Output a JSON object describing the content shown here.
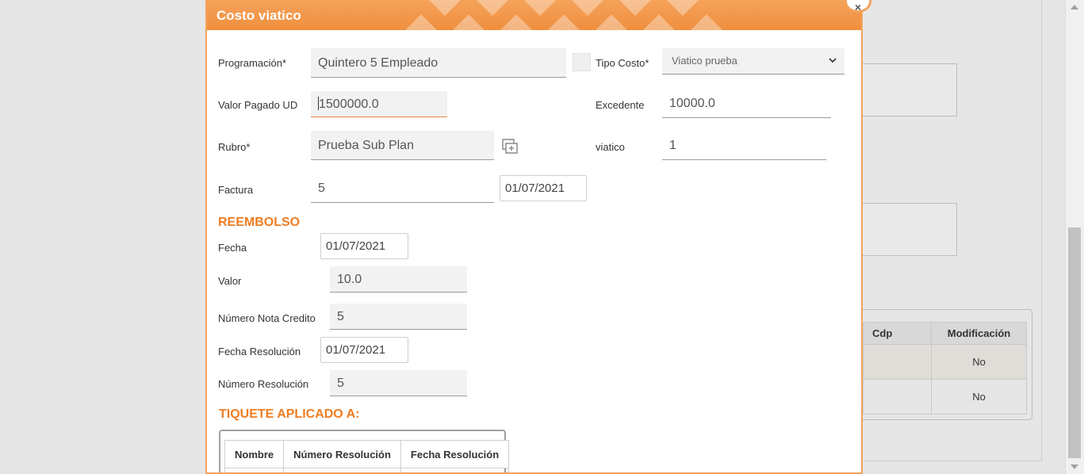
{
  "modal": {
    "title": "Costo viatico",
    "close_symbol": "×"
  },
  "form": {
    "programacion": {
      "label": "Programación*",
      "value": "Quintero 5 Empleado"
    },
    "tipo_costo": {
      "label": "Tipo Costo*",
      "value": "Viatico prueba"
    },
    "valor_pagado": {
      "label": "Valor Pagado UD",
      "value": "1500000.0"
    },
    "excedente": {
      "label": "Excedente",
      "value": "10000.0"
    },
    "rubro": {
      "label": "Rubro*",
      "value": "Prueba Sub Plan"
    },
    "viatico": {
      "label": "viatico",
      "value": "1"
    },
    "factura": {
      "label": "Factura",
      "value": "5",
      "date": "01/07/2021"
    }
  },
  "reembolso": {
    "title": "REEMBOLSO",
    "fecha": {
      "label": "Fecha",
      "value": "01/07/2021"
    },
    "valor": {
      "label": "Valor",
      "value": "10.0"
    },
    "numero_nota": {
      "label": "Número Nota Credito",
      "value": "5"
    },
    "fecha_resolucion": {
      "label": "Fecha Resolución",
      "value": "01/07/2021"
    },
    "numero_resolucion": {
      "label": "Número Resolución",
      "value": "5"
    }
  },
  "tiquete": {
    "title": "TIQUETE APLICADO A:",
    "columns": [
      "Nombre",
      "Número Resolución",
      "Fecha Resolución"
    ]
  },
  "background_table": {
    "columns": [
      "Cdp",
      "Modificación"
    ],
    "rows": [
      [
        "",
        "No"
      ],
      [
        "",
        "No"
      ]
    ]
  },
  "colors": {
    "accent": "#ef7d22",
    "header": "#f3a45c"
  }
}
